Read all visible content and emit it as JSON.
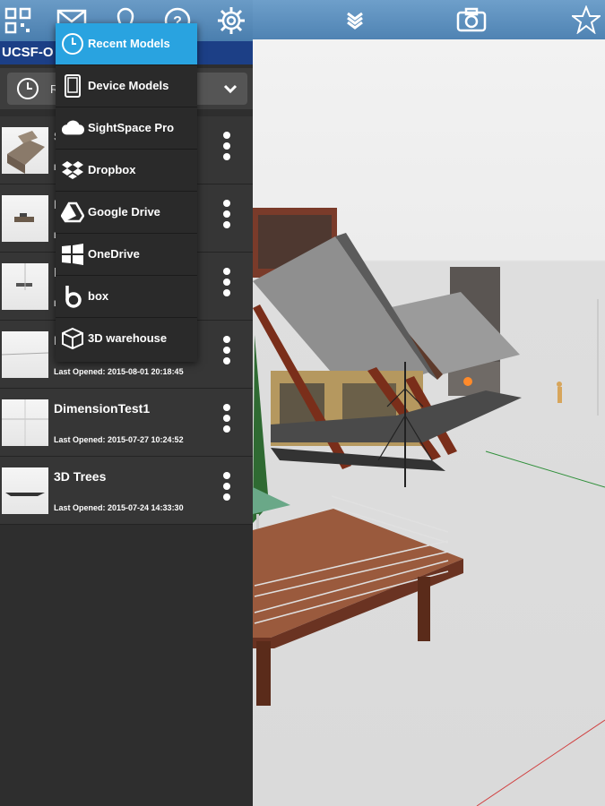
{
  "toolbar": {
    "icons": [
      "qr-code-icon",
      "mail-icon",
      "location-pin-icon",
      "help-icon",
      "gear-icon",
      "layers-icon",
      "camera-icon",
      "star-icon"
    ]
  },
  "project": {
    "name": "UCSF-O"
  },
  "source_selector": {
    "current_label": "Re"
  },
  "dropdown": {
    "items": [
      {
        "label": "Recent Models",
        "icon": "clock-icon",
        "active": true
      },
      {
        "label": "Device Models",
        "icon": "tablet-icon"
      },
      {
        "label": "SightSpace Pro",
        "icon": "cloud-icon"
      },
      {
        "label": "Dropbox",
        "icon": "dropbox-icon"
      },
      {
        "label": "Google Drive",
        "icon": "google-drive-icon"
      },
      {
        "label": "OneDrive",
        "icon": "windows-icon"
      },
      {
        "label": "box",
        "icon": "box-logo-icon"
      },
      {
        "label": "3D warehouse",
        "icon": "cube-icon"
      }
    ]
  },
  "models": [
    {
      "name": "S",
      "last_opened": "L"
    },
    {
      "name": "I",
      "last_opened": "L"
    },
    {
      "name": "l",
      "last_opened": "L"
    },
    {
      "name": "I",
      "last_opened": "Last Opened: 2015-08-01 20:18:45"
    },
    {
      "name": "DimensionTest1",
      "last_opened": "Last Opened: 2015-07-27 10:24:52"
    },
    {
      "name": "3D Trees",
      "last_opened": "Last Opened: 2015-07-24 14:33:30"
    }
  ],
  "colors": {
    "accent": "#29a3e0",
    "project_bar": "#1c3f86",
    "toolbar": "#5b8ec0",
    "panel": "#2e2e2e"
  }
}
